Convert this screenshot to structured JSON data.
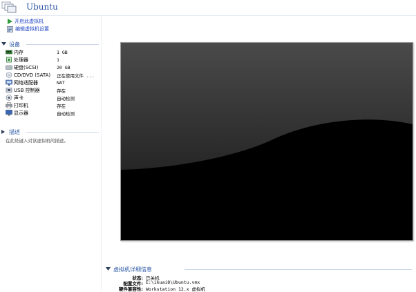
{
  "header": {
    "title": "Ubuntu",
    "icon": "vm-stack-icon"
  },
  "actions": [
    {
      "label": "开启此虚拟机",
      "icon": "play-icon"
    },
    {
      "label": "编辑虚拟机设置",
      "icon": "settings-icon"
    }
  ],
  "devices": {
    "heading": "设备",
    "items": [
      {
        "name": "内存",
        "value": "1 GB",
        "icon": "memory-icon"
      },
      {
        "name": "处理器",
        "value": "1",
        "icon": "cpu-icon"
      },
      {
        "name": "硬盘(SCSI)",
        "value": "20 GB",
        "icon": "hard-disk-icon"
      },
      {
        "name": "CD/DVD (SATA)",
        "value": "正在使用文件 ...",
        "icon": "cd-dvd-icon"
      },
      {
        "name": "网络适配器",
        "value": "NAT",
        "icon": "network-adapter-icon"
      },
      {
        "name": "USB 控制器",
        "value": "存在",
        "icon": "usb-controller-icon"
      },
      {
        "name": "声卡",
        "value": "自动检测",
        "icon": "sound-card-icon"
      },
      {
        "name": "打印机",
        "value": "存在",
        "icon": "printer-icon"
      },
      {
        "name": "显示器",
        "value": "自动检测",
        "icon": "display-icon"
      }
    ]
  },
  "description": {
    "heading": "描述",
    "placeholder": "在此处键入对该虚拟机的描述。"
  },
  "details": {
    "heading": "虚拟机详细信息",
    "rows": [
      {
        "key": "状态:",
        "value": "已关机"
      },
      {
        "key": "配置文件:",
        "value": "E:\\ikuai8\\Ubuntu.vmx"
      },
      {
        "key": "硬件兼容性:",
        "value": "Workstation 12.x 虚拟机"
      }
    ]
  },
  "colors": {
    "accent": "#2c58a6",
    "link": "#1f43c4",
    "play": "#2e9b3a",
    "screen": "#000000"
  }
}
